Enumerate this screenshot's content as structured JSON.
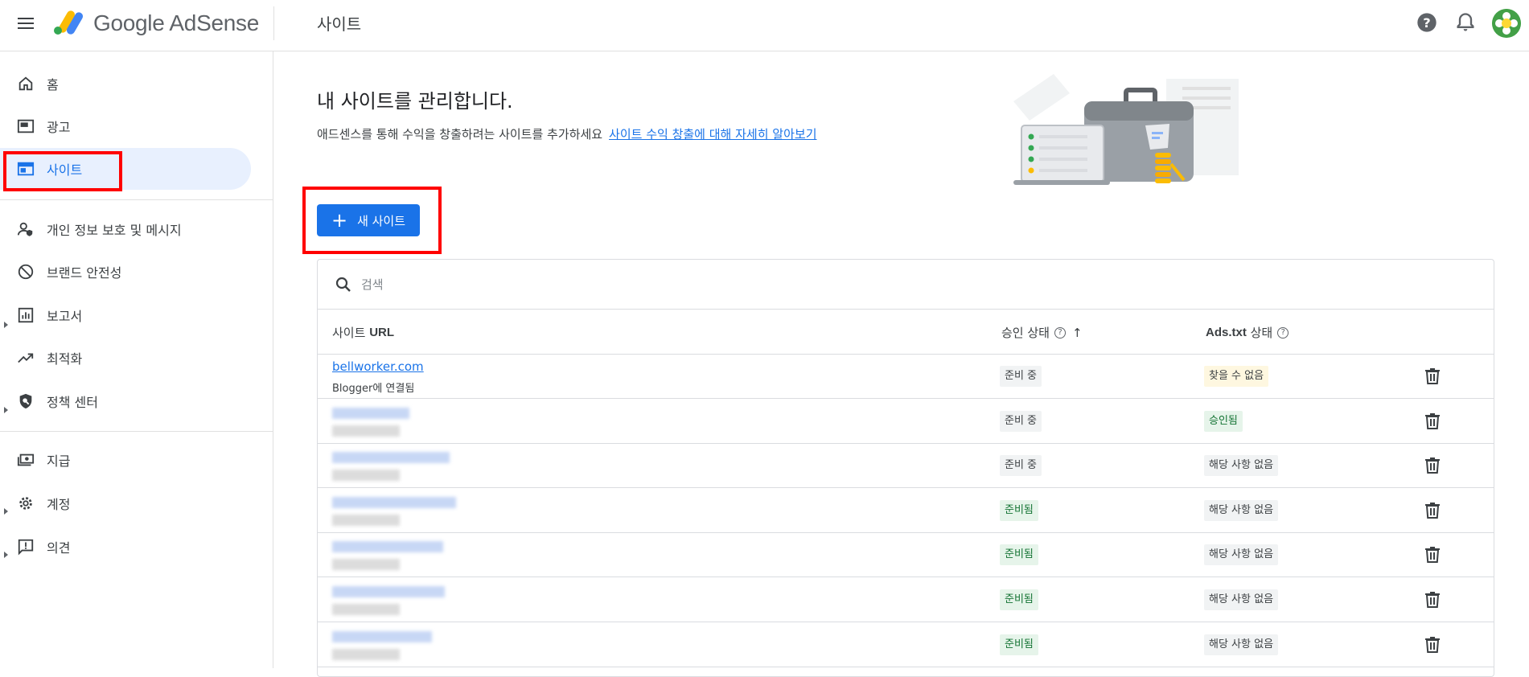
{
  "header": {
    "app_name": "Google AdSense",
    "page_title": "사이트"
  },
  "sidebar": {
    "items": [
      {
        "label": "홈",
        "icon": "home-icon"
      },
      {
        "label": "광고",
        "icon": "ads-icon"
      },
      {
        "label": "사이트",
        "icon": "sites-icon",
        "active": true
      },
      {
        "label": "개인 정보 보호 및 메시지",
        "icon": "privacy-icon"
      },
      {
        "label": "브랜드 안전성",
        "icon": "block-icon"
      },
      {
        "label": "보고서",
        "icon": "reports-icon"
      },
      {
        "label": "최적화",
        "icon": "trending-up-icon"
      },
      {
        "label": "정책 센터",
        "icon": "policy-shield-icon"
      },
      {
        "label": "지급",
        "icon": "payments-icon"
      },
      {
        "label": "계정",
        "icon": "gear-icon"
      },
      {
        "label": "의견",
        "icon": "feedback-icon"
      }
    ]
  },
  "main": {
    "title": "내 사이트를 관리합니다.",
    "subtitle": "애드센스를 통해 수익을 창출하려는 사이트를 추가하세요",
    "learn_link": "사이트 수익 창출에 대해 자세히 알아보기",
    "new_site_label": "새 사이트",
    "search_placeholder": "검색"
  },
  "table": {
    "columns": {
      "url_prefix": "사이트",
      "url_bold": "URL",
      "status": "승인 상태",
      "ads_prefix": "Ads.txt",
      "ads_suffix": "상태"
    },
    "rows": [
      {
        "url": "bellworker.com",
        "sub": "Blogger에 연결됨",
        "status": "준비 중",
        "status_color": "gray",
        "ads": "찾을 수 없음",
        "ads_color": "yellow"
      },
      {
        "url": "",
        "sub": "",
        "status": "준비 중",
        "status_color": "gray",
        "ads": "승인됨",
        "ads_color": "green"
      },
      {
        "url": "",
        "sub": "",
        "status": "준비 중",
        "status_color": "gray",
        "ads": "해당 사항 없음",
        "ads_color": "gray"
      },
      {
        "url": "",
        "sub": "",
        "status": "준비됨",
        "status_color": "green",
        "ads": "해당 사항 없음",
        "ads_color": "gray"
      },
      {
        "url": "",
        "sub": "",
        "status": "준비됨",
        "status_color": "green",
        "ads": "해당 사항 없음",
        "ads_color": "gray"
      },
      {
        "url": "",
        "sub": "",
        "status": "준비됨",
        "status_color": "green",
        "ads": "해당 사항 없음",
        "ads_color": "gray"
      },
      {
        "url": "",
        "sub": "",
        "status": "준비됨",
        "status_color": "green",
        "ads": "해당 사항 없음",
        "ads_color": "gray"
      }
    ]
  },
  "colors": {
    "accent": "#1a73e8",
    "highlight": "#ff0000",
    "active_bg": "#e8f0fe"
  }
}
